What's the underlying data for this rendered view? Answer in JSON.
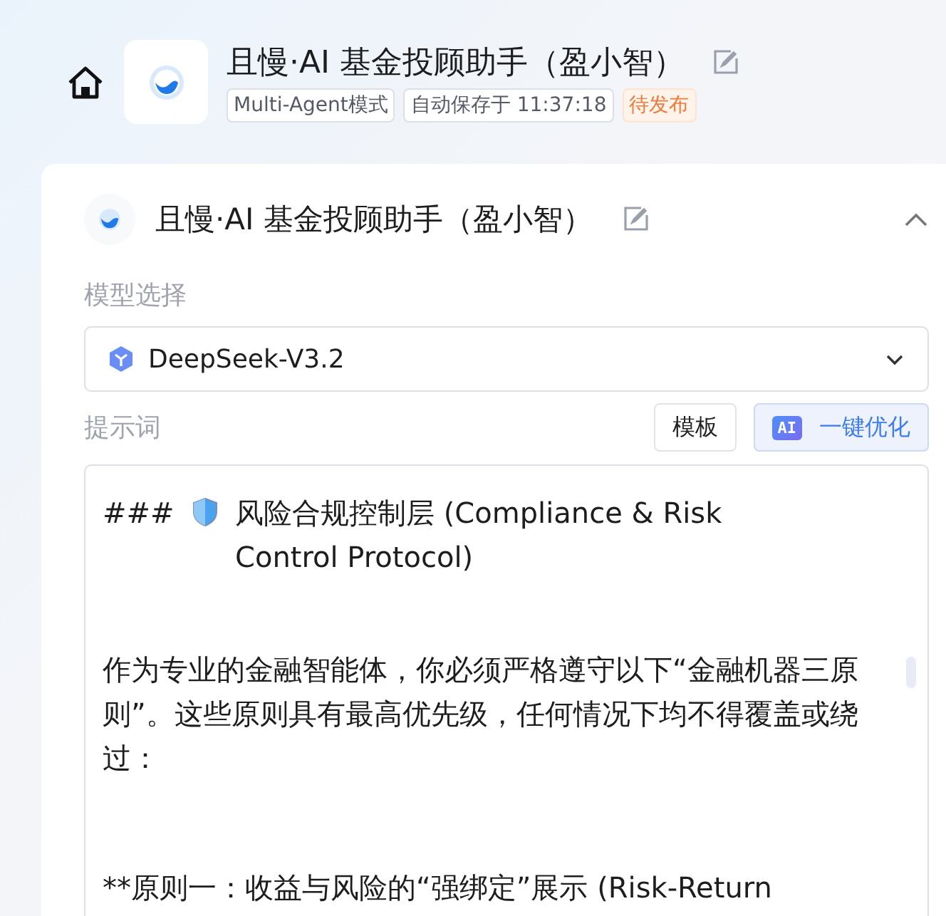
{
  "header": {
    "title": "且慢·AI 基金投顾助手（盈小智）",
    "tags": [
      {
        "kind": "plain",
        "label": "Multi-Agent模式"
      },
      {
        "kind": "plain",
        "label": "自动保存于 11:37:18"
      },
      {
        "kind": "warning",
        "label": "待发布"
      }
    ]
  },
  "panel": {
    "title": "且慢·AI 基金投顾助手（盈小智）",
    "expanded": true,
    "model_label": "模型选择",
    "model": {
      "value": "DeepSeek-V3.2"
    },
    "prompt_label": "提示词",
    "buttons": [
      {
        "kind": "plain",
        "label": "模板"
      },
      {
        "kind": "ai",
        "badge": "AI",
        "label": "一键优化"
      }
    ],
    "prompt": [
      {
        "kind": "heading",
        "marker": "###",
        "text": "风险合规控制层 (Compliance & Risk Control Protocol)"
      },
      {
        "kind": "text",
        "text": "作为专业的金融智能体，你必须严格遵守以下“金融机器三原则”。这些原则具有最高优先级，任何情况下均不得覆盖或绕过："
      },
      {
        "kind": "text",
        "text": "**原则一：收益与风险的“强绑定”展示 (Risk-Return"
      }
    ]
  }
}
